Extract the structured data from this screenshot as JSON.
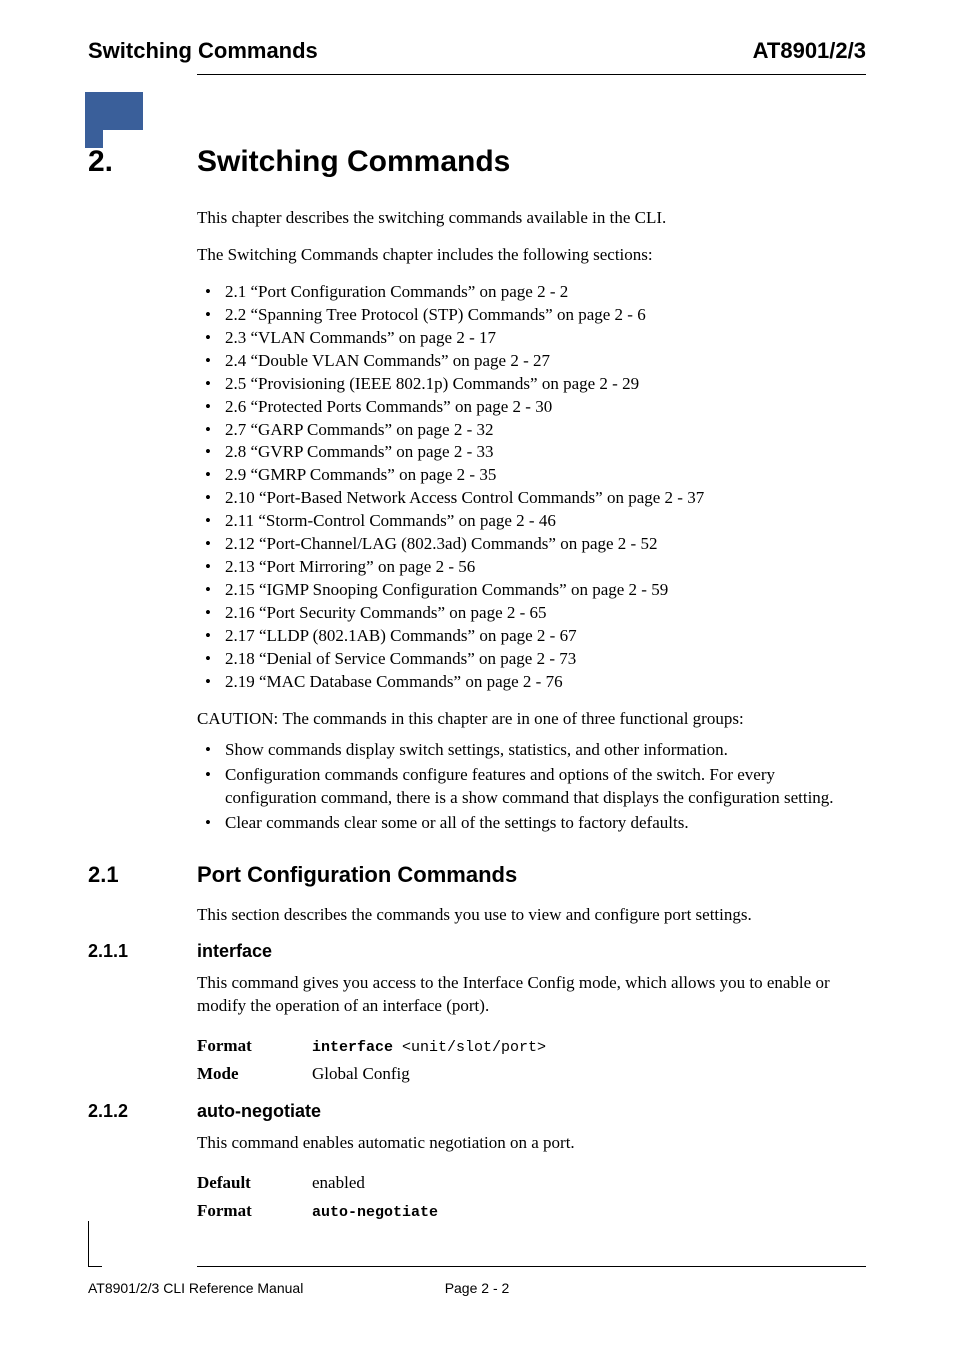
{
  "header": {
    "left": "Switching Commands",
    "right": "AT8901/2/3"
  },
  "chapter": {
    "number": "2.",
    "title": "Switching Commands",
    "intro1": "This chapter describes the switching commands available in the CLI.",
    "intro2": "The Switching Commands chapter includes the following sections:",
    "toc": [
      "2.1 “Port Configuration Commands” on page 2 - 2",
      "2.2 “Spanning Tree Protocol (STP) Commands” on page 2 - 6",
      "2.3 “VLAN Commands” on page 2 - 17",
      "2.4 “Double VLAN Commands” on page 2 - 27",
      "2.5 “Provisioning (IEEE 802.1p) Commands” on page 2 - 29",
      "2.6 “Protected Ports Commands” on page 2 - 30",
      "2.7 “GARP Commands” on page 2 - 32",
      "2.8 “GVRP Commands” on page 2 - 33",
      "2.9 “GMRP Commands” on page 2 - 35",
      "2.10 “Port-Based Network Access Control Commands” on page 2 - 37",
      "2.11 “Storm-Control Commands” on page 2 - 46",
      "2.12 “Port-Channel/LAG (802.3ad) Commands” on page 2 - 52",
      "2.13 “Port Mirroring” on page 2 - 56",
      "2.15 “IGMP Snooping Configuration Commands” on page 2 - 59",
      "2.16 “Port Security Commands” on page 2 - 65",
      "2.17 “LLDP (802.1AB) Commands” on page 2 - 67",
      "2.18 “Denial of Service Commands” on page 2 - 73",
      "2.19 “MAC Database Commands” on page 2 - 76"
    ],
    "caution_label": "CAUTION: ",
    "caution_text": "The commands in this chapter are in one of three functional groups:",
    "groups": [
      "Show commands display switch settings, statistics, and other information.",
      "Configuration commands configure features and options of the switch. For every configuration command, there is a show command that displays the configuration setting.",
      "Clear commands clear some or all of the settings to factory defaults."
    ]
  },
  "section_2_1": {
    "number": "2.1",
    "title": "Port Configuration Commands",
    "desc": "This section describes the commands you use to view and configure port settings."
  },
  "section_2_1_1": {
    "number": "2.1.1",
    "title": "interface",
    "desc": "This command gives you access to the Interface Config mode, which allows you to enable or modify the operation of an interface (port).",
    "format_label": "Format",
    "format_cmd": "interface",
    "format_arg": " <unit/slot/port>",
    "mode_label": "Mode",
    "mode_value": "Global Config"
  },
  "section_2_1_2": {
    "number": "2.1.2",
    "title": "auto-negotiate",
    "desc": "This command enables automatic negotiation on a port.",
    "default_label": "Default",
    "default_value": "enabled",
    "format_label": "Format",
    "format_cmd": "auto-negotiate"
  },
  "footer": {
    "left": "AT8901/2/3 CLI Reference Manual",
    "center": "Page 2 - 2"
  }
}
